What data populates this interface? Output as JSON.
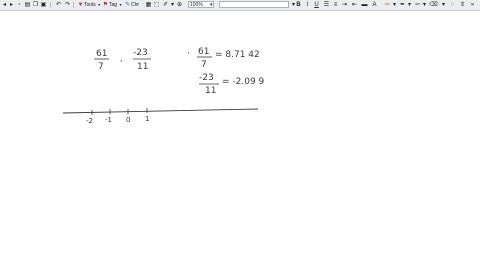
{
  "toolbar": {
    "tools_label": "Tools",
    "tag_label": "Tag",
    "zoom_value": "100%",
    "chars_label": "Chr",
    "icons": [
      "back-icon",
      "forward-icon",
      "new-page-icon",
      "print-icon",
      "copy-icon",
      "paste-icon",
      "undo-icon",
      "redo-icon"
    ]
  },
  "canvas": {
    "left_fraction_1": {
      "numerator": "61",
      "denominator": "7"
    },
    "comma": ",",
    "left_fraction_2": {
      "numerator": "-23",
      "denominator": "11"
    },
    "right_bullet": "·",
    "right_fraction_1": {
      "numerator": "61",
      "denominator": "7"
    },
    "right_value_1": "= 8.71 42",
    "right_fraction_2": {
      "numerator": "-23",
      "denominator": "11"
    },
    "right_value_2": "= -2.09 9",
    "number_line": {
      "tick_labels": [
        "-2",
        "-1",
        "0",
        "1"
      ]
    }
  }
}
